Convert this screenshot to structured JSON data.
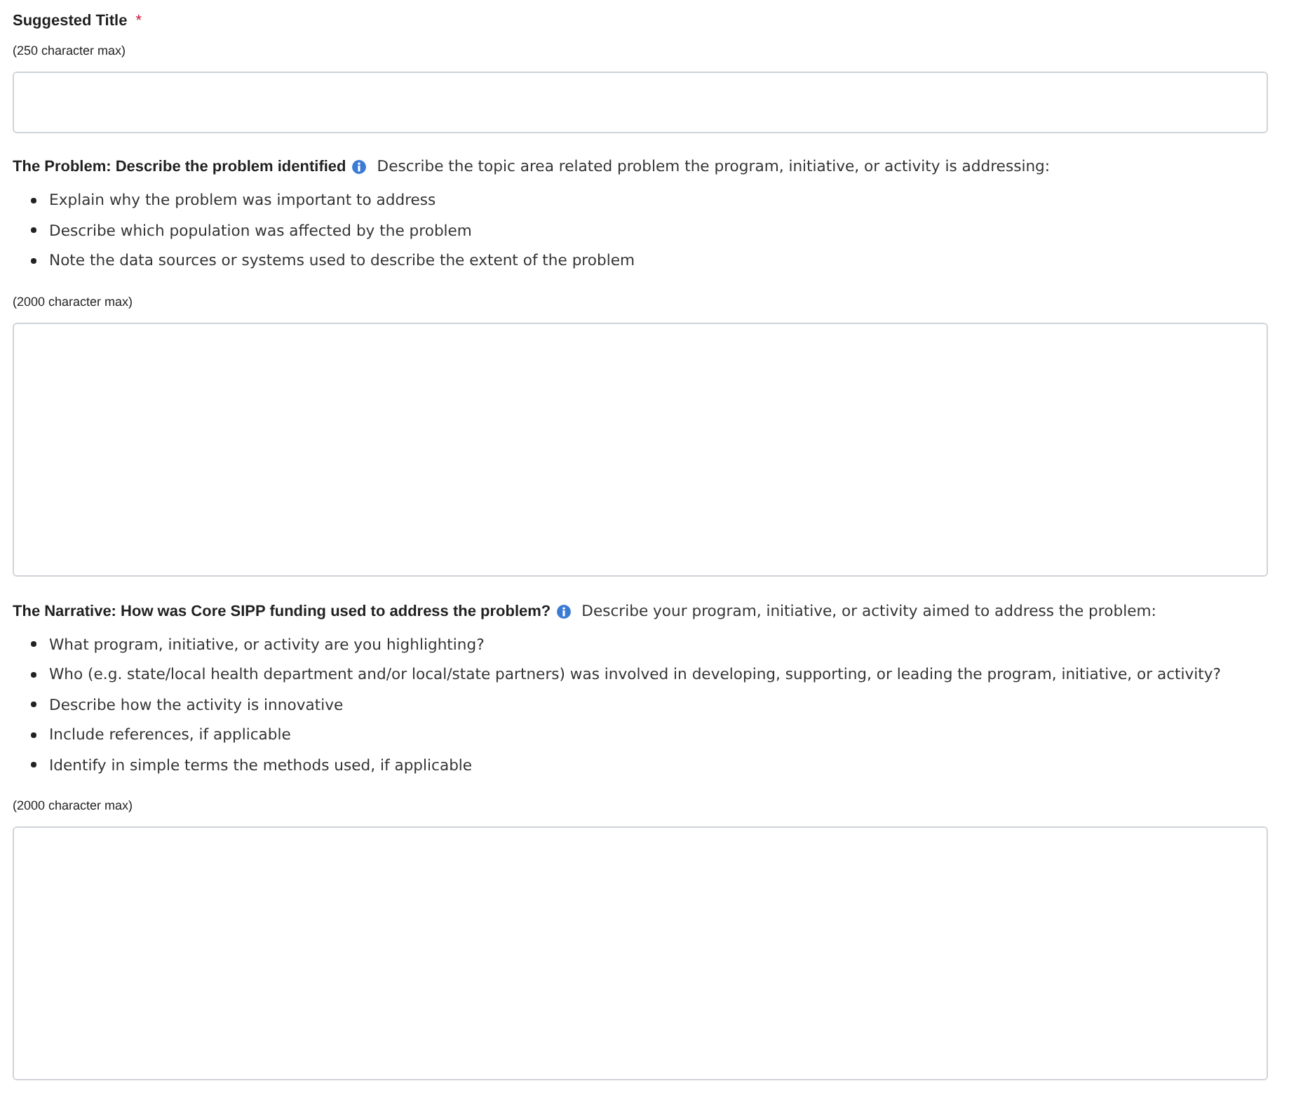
{
  "fields": [
    {
      "kind": "input",
      "label": "Suggested Title",
      "required": true,
      "required_mark": "*",
      "info": false,
      "hint": "(250 character max)"
    },
    {
      "kind": "textarea",
      "label": "The Problem: Describe the problem identified",
      "required": false,
      "info": true,
      "description": "Describe the topic area related problem the program, initiative, or activity is addressing:",
      "bullets": [
        "Explain why the problem was important to address",
        "Describe which population was affected by the problem",
        "Note the data sources or systems used to describe the extent of the problem"
      ],
      "hint": "(2000 character max)"
    },
    {
      "kind": "textarea",
      "label": "The Narrative: How was Core SIPP funding used to address the problem?",
      "required": false,
      "info": true,
      "description": "Describe your program, initiative, or activity aimed to address the problem:",
      "bullets": [
        "What program, initiative, or activity are you highlighting?",
        "Who (e.g. state/local health department and/or local/state partners) was involved in developing, supporting, or leading the program, initiative, or activity?",
        "Describe how the activity is innovative",
        "Include references, if applicable",
        "Identify in simple terms the methods used, if applicable"
      ],
      "hint": "(2000 character max)"
    }
  ]
}
